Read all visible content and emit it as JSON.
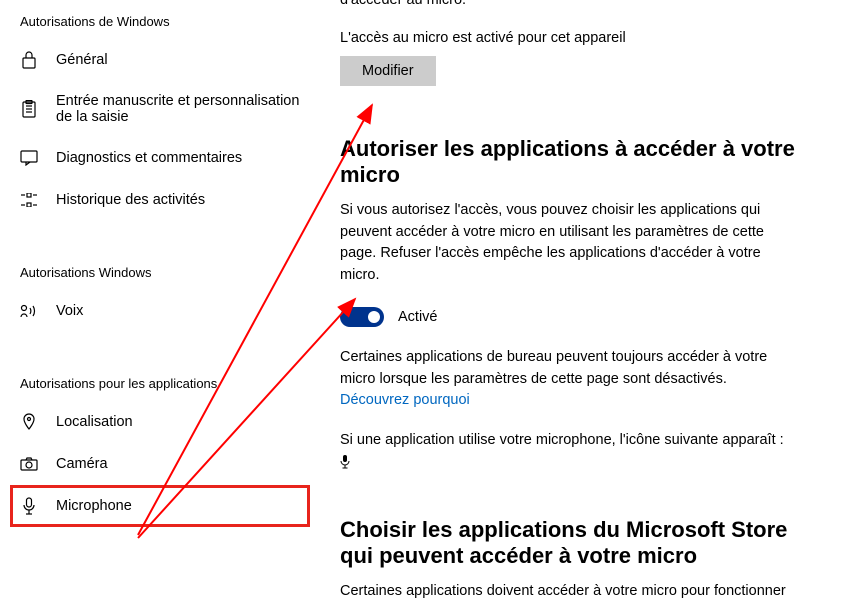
{
  "sidebar": {
    "section1": "Autorisations de Windows",
    "items1": [
      {
        "label": "Général"
      },
      {
        "label": "Entrée manuscrite et personnalisation de la saisie"
      },
      {
        "label": "Diagnostics et commentaires"
      },
      {
        "label": "Historique des activités"
      }
    ],
    "section2": "Autorisations Windows",
    "items2": [
      {
        "label": "Voix"
      }
    ],
    "section3": "Autorisations pour les applications",
    "items3": [
      {
        "label": "Localisation"
      },
      {
        "label": "Caméra"
      },
      {
        "label": "Microphone"
      }
    ]
  },
  "content": {
    "truncated": "d'accéder au micro.",
    "status": "L'accès au micro est activé pour cet appareil",
    "modify_btn": "Modifier",
    "allow_title": "Autoriser les applications à accéder à votre micro",
    "allow_desc": "Si vous autorisez l'accès, vous pouvez choisir les applications qui peuvent accéder à votre micro en utilisant les paramètres de cette page. Refuser l'accès empêche les applications d'accéder à votre micro.",
    "toggle_label": "Activé",
    "desktop_note_a": "Certaines applications de bureau peuvent toujours accéder à votre micro lorsque les paramètres de cette page sont désactivés. ",
    "discover_link": "Découvrez pourquoi",
    "icon_note": "Si une application utilise votre microphone, l'icône suivante apparaît :",
    "choose_title": "Choisir les applications du Microsoft Store qui peuvent accéder à votre micro",
    "choose_desc": "Certaines applications doivent accéder à votre micro pour fonctionner"
  }
}
